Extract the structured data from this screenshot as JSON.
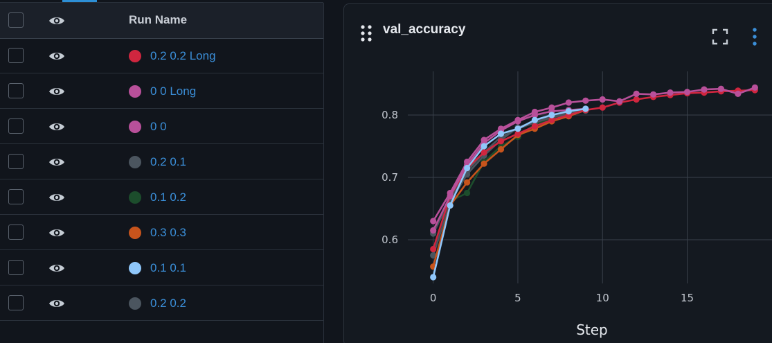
{
  "runs_table": {
    "header": {
      "name_label": "Run Name"
    },
    "runs": [
      {
        "name": "0.2 0.2 Long",
        "color": "#d0263f"
      },
      {
        "name": "0 0 Long",
        "color": "#b8509a"
      },
      {
        "name": "0 0",
        "color": "#b8509a"
      },
      {
        "name": "0.2 0.1",
        "color": "#4b555f"
      },
      {
        "name": "0.1 0.2",
        "color": "#1c4d2c"
      },
      {
        "name": "0.3 0.3",
        "color": "#c7541c"
      },
      {
        "name": "0.1 0.1",
        "color": "#8fc7fb"
      },
      {
        "name": "0.2 0.2",
        "color": "#4b555f"
      }
    ]
  },
  "chart": {
    "title": "val_accuracy"
  },
  "chart_data": {
    "type": "line",
    "title": "val_accuracy",
    "xlabel": "Step",
    "ylabel": "",
    "xlim": [
      -1.5,
      20.5
    ],
    "ylim": [
      0.53,
      0.87
    ],
    "x_ticks": [
      0,
      5,
      10,
      15
    ],
    "y_ticks": [
      0.6,
      0.7,
      0.8
    ],
    "grid": true,
    "series": [
      {
        "name": "0.2 0.2 Long",
        "color": "#d0263f",
        "x": [
          0,
          1,
          2,
          3,
          4,
          5,
          6,
          7,
          8,
          9,
          10,
          11,
          12,
          13,
          14,
          15,
          16,
          17,
          18,
          19
        ],
        "y": [
          0.585,
          0.67,
          0.715,
          0.74,
          0.758,
          0.77,
          0.782,
          0.792,
          0.8,
          0.808,
          0.812,
          0.82,
          0.825,
          0.829,
          0.832,
          0.835,
          0.836,
          0.838,
          0.839,
          0.84
        ]
      },
      {
        "name": "0 0 Long",
        "color": "#b8509a",
        "x": [
          0,
          1,
          2,
          3,
          4,
          5,
          6,
          7,
          8,
          9,
          10,
          11,
          12,
          13,
          14,
          15,
          16,
          17,
          18,
          19
        ],
        "y": [
          0.63,
          0.675,
          0.725,
          0.76,
          0.778,
          0.792,
          0.805,
          0.812,
          0.82,
          0.823,
          0.825,
          0.822,
          0.834,
          0.833,
          0.836,
          0.837,
          0.841,
          0.842,
          0.834,
          0.844
        ]
      },
      {
        "name": "0 0",
        "color": "#b8509a",
        "x": [
          0,
          1,
          2,
          3,
          4,
          5,
          6,
          7,
          8,
          9
        ],
        "y": [
          0.615,
          0.67,
          0.72,
          0.755,
          0.775,
          0.79,
          0.8,
          0.806,
          0.808,
          0.81
        ]
      },
      {
        "name": "0.2 0.1",
        "color": "#4b555f",
        "x": [
          0,
          1,
          2,
          3,
          4,
          5,
          6,
          7,
          8,
          9
        ],
        "y": [
          0.575,
          0.66,
          0.705,
          0.735,
          0.76,
          0.78,
          0.79,
          0.798,
          0.804,
          0.808
        ]
      },
      {
        "name": "0.1 0.2",
        "color": "#1c4d2c",
        "x": [
          0,
          1,
          2,
          3,
          4,
          5,
          6,
          7,
          8,
          9
        ],
        "y": [
          0.612,
          0.662,
          0.675,
          0.725,
          0.75,
          0.765,
          0.785,
          0.795,
          0.803,
          0.809
        ]
      },
      {
        "name": "0.3 0.3",
        "color": "#c7541c",
        "x": [
          0,
          1,
          2,
          3,
          4,
          5,
          6,
          7,
          8,
          9
        ],
        "y": [
          0.557,
          0.655,
          0.692,
          0.722,
          0.745,
          0.768,
          0.778,
          0.79,
          0.798,
          0.808
        ]
      },
      {
        "name": "0.1 0.1",
        "color": "#8fc7fb",
        "x": [
          0,
          1,
          2,
          3,
          4,
          5,
          6,
          7,
          8,
          9
        ],
        "y": [
          0.54,
          0.655,
          0.715,
          0.75,
          0.77,
          0.778,
          0.792,
          0.8,
          0.806,
          0.81
        ]
      },
      {
        "name": "0.2 0.2",
        "color": "#4b555f",
        "x": [
          0,
          1,
          2,
          3,
          4,
          5,
          6,
          7,
          8,
          9
        ],
        "y": [
          0.61,
          0.665,
          0.71,
          0.74,
          0.765,
          0.778,
          0.788,
          0.796,
          0.802,
          0.807
        ]
      }
    ]
  },
  "icons": {
    "eye": "eye-icon",
    "drag": "drag-handle-icon",
    "fullscreen": "fullscreen-icon",
    "more": "kebab-menu-icon"
  },
  "colors": {
    "accent": "#2d8fd6",
    "link": "#3b8fd9",
    "background": "#11151c",
    "panel": "#141920"
  }
}
